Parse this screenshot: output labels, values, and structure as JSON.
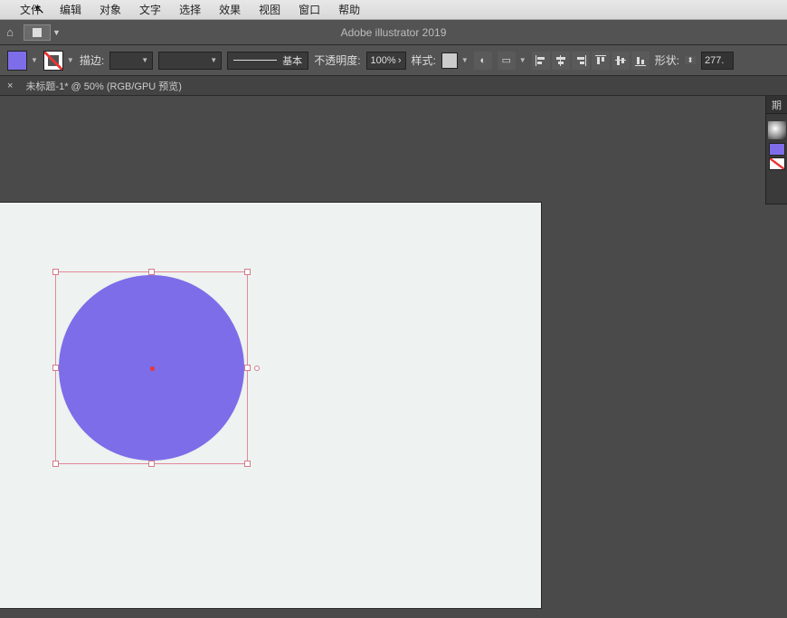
{
  "app": {
    "title": "Adobe illustrator 2019"
  },
  "menu": {
    "file": "文件",
    "edit": "编辑",
    "object": "对象",
    "type": "文字",
    "select": "选择",
    "effect": "效果",
    "view": "视图",
    "window": "窗口",
    "help": "帮助"
  },
  "ctrl": {
    "stroke_label": "描边:",
    "stroke_weight": "",
    "brush_label": "基本",
    "opacity_label": "不透明度:",
    "opacity_value": "100%",
    "style_label": "样式:",
    "shape_label": "形状:",
    "shape_value": "277."
  },
  "doc": {
    "close": "×",
    "tab": "未标题-1* @ 50% (RGB/GPU 预览)"
  },
  "panel": {
    "tab": "期"
  },
  "colors": {
    "fill": "#7d6de8",
    "artboard": "#eef2f0",
    "selection": "#e28a9a"
  }
}
